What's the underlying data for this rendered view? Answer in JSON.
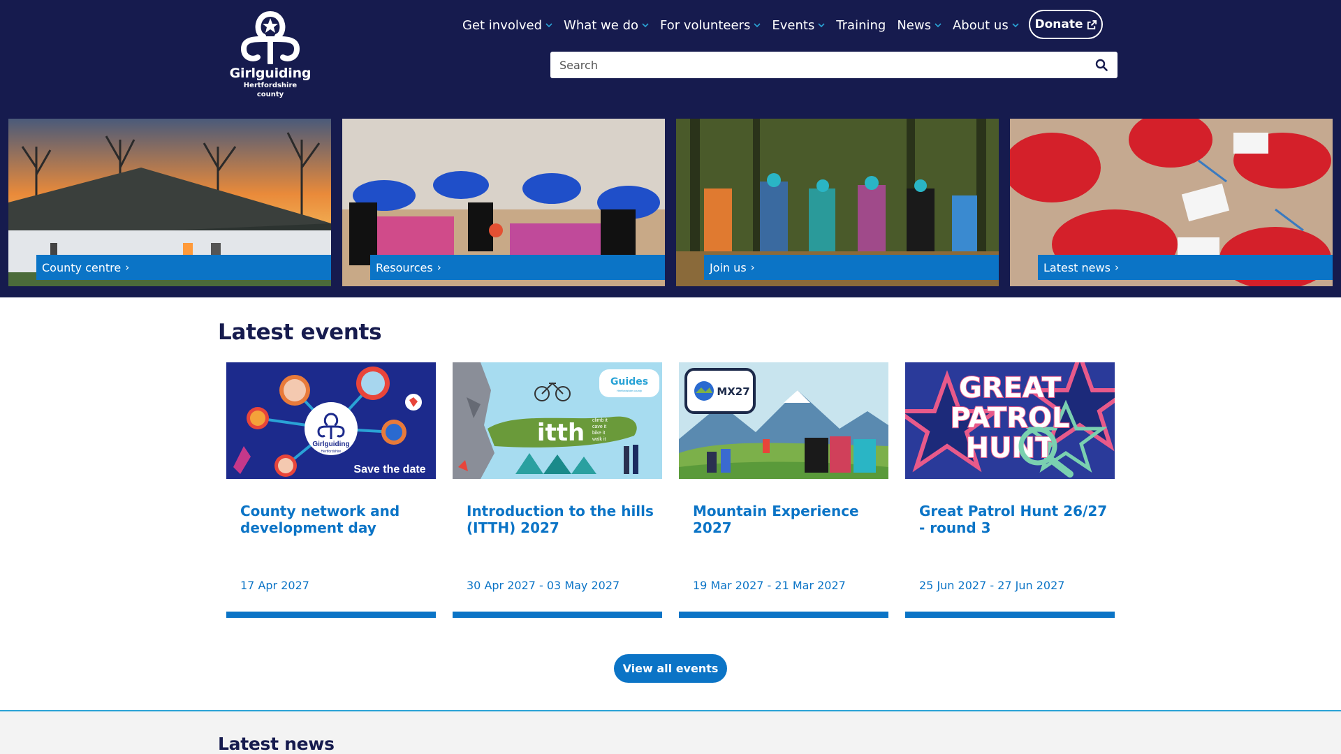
{
  "logo": {
    "name": "Girlguiding",
    "sub1": "Hertfordshire",
    "sub2": "county"
  },
  "nav": [
    {
      "label": "Get involved",
      "dropdown": true
    },
    {
      "label": "What we do",
      "dropdown": true
    },
    {
      "label": "For volunteers",
      "dropdown": true
    },
    {
      "label": "Events",
      "dropdown": true
    },
    {
      "label": "Training",
      "dropdown": false
    },
    {
      "label": "News",
      "dropdown": true
    },
    {
      "label": "About us",
      "dropdown": true
    }
  ],
  "donate": {
    "label": "Donate"
  },
  "search": {
    "placeholder": "Search"
  },
  "tiles": [
    {
      "label": "County centre"
    },
    {
      "label": "Resources"
    },
    {
      "label": "Join us"
    },
    {
      "label": "Latest news"
    }
  ],
  "events": {
    "title": "Latest events",
    "cards": [
      {
        "title": "County network and development day",
        "date": "17 Apr 2027",
        "image_text": "Save the date",
        "logo_text": "Girlguiding",
        "logo_sub": "Hertfordshire"
      },
      {
        "title": "Introduction to the hills (ITTH) 2027",
        "date": "30 Apr 2027 - 03 May 2027",
        "image_text": "itth",
        "brand": "Guides",
        "brand_sub": "Hertfordshire county",
        "tagline": [
          "climb it",
          "cave it",
          "bike it",
          "walk it"
        ]
      },
      {
        "title": "Mountain Experience 2027",
        "date": "19 Mar 2027 - 21 Mar 2027",
        "image_text": "MX27"
      },
      {
        "title": "Great Patrol Hunt 26/27 - round 3",
        "date": "25 Jun 2027 - 27 Jun 2027",
        "image_lines": [
          "GREAT",
          "PATROL",
          "HUNT"
        ]
      }
    ],
    "view_all": "View all events"
  },
  "news": {
    "title": "Latest news"
  },
  "colors": {
    "navy": "#161b4e",
    "blue": "#0b74c6",
    "white": "#ffffff",
    "light_bg": "#f3f3f3",
    "divider": "#2aa3d6"
  },
  "icons": {
    "search": "search-icon",
    "external": "external-link-icon",
    "chevron": "chevron-down-icon"
  }
}
